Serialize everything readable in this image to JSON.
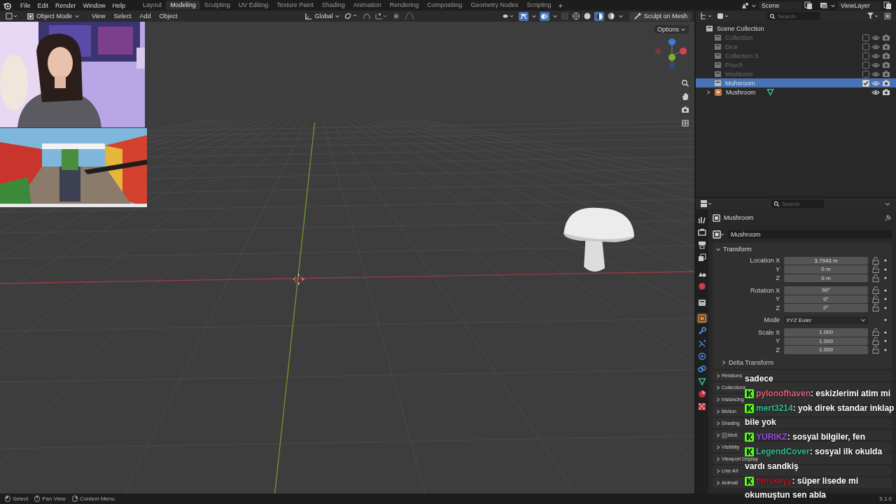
{
  "menu": [
    "File",
    "Edit",
    "Render",
    "Window",
    "Help"
  ],
  "workspaces": [
    {
      "label": "Layout",
      "selected": false
    },
    {
      "label": "Modeling",
      "selected": true
    },
    {
      "label": "Sculpting",
      "selected": false
    },
    {
      "label": "UV Editing",
      "selected": false
    },
    {
      "label": "Texture Paint",
      "selected": false
    },
    {
      "label": "Shading",
      "selected": false
    },
    {
      "label": "Animation",
      "selected": false
    },
    {
      "label": "Rendering",
      "selected": false
    },
    {
      "label": "Compositing",
      "selected": false
    },
    {
      "label": "Geometry Nodes",
      "selected": false
    },
    {
      "label": "Scripting",
      "selected": false
    }
  ],
  "add_workspace": "+",
  "scene": "Scene",
  "view_layer": "ViewLayer",
  "viewport": {
    "mode": "Object Mode",
    "menus": [
      "View",
      "Select",
      "Add",
      "Object"
    ],
    "orientation": "Global",
    "sculpt_button": "Sculpt on Mesh",
    "options": "Options"
  },
  "outliner": {
    "search_placeholder": "Search",
    "root": "Scene Collection",
    "items": [
      {
        "label": "Collection",
        "kind": "collection",
        "checked": false,
        "selected": false
      },
      {
        "label": "Dice",
        "kind": "collection",
        "checked": false,
        "selected": false
      },
      {
        "label": "Collection 3",
        "kind": "collection",
        "checked": false,
        "selected": false
      },
      {
        "label": "Pouch",
        "kind": "collection",
        "checked": false,
        "selected": false
      },
      {
        "label": "Wishbone",
        "kind": "collection",
        "checked": false,
        "selected": false
      },
      {
        "label": "Muhsroom",
        "kind": "collection",
        "checked": true,
        "selected": true
      },
      {
        "label": "Mushroom",
        "kind": "object",
        "expanded": false,
        "selected": false
      }
    ]
  },
  "properties": {
    "search_placeholder": "Search",
    "tabs": [
      {
        "kind": "tool",
        "selected": false
      },
      {
        "kind": "render",
        "selected": false
      },
      {
        "kind": "output",
        "selected": false
      },
      {
        "kind": "view",
        "selected": false
      },
      {
        "kind": "scene",
        "selected": false
      },
      {
        "kind": "world",
        "selected": false
      },
      {
        "kind": "collection",
        "selected": false
      },
      {
        "kind": "object",
        "selected": true
      },
      {
        "kind": "modifier",
        "selected": false
      },
      {
        "kind": "particles",
        "selected": false
      },
      {
        "kind": "physics",
        "selected": false
      },
      {
        "kind": "constraints",
        "selected": false
      },
      {
        "kind": "data",
        "selected": false
      },
      {
        "kind": "material",
        "selected": false
      },
      {
        "kind": "texture",
        "selected": false
      }
    ],
    "object_name": "Mushroom",
    "name_field": "Mushroom",
    "transform": {
      "label": "Transform",
      "expanded": true,
      "groups": [
        [
          {
            "label": "Location X",
            "value": "3.7943 m",
            "kind": "number"
          },
          {
            "label": "Y",
            "value": "0 m",
            "kind": "number"
          },
          {
            "label": "Z",
            "value": "0 m",
            "kind": "number"
          }
        ],
        [
          {
            "label": "Rotation X",
            "value": "90°",
            "kind": "number"
          },
          {
            "label": "Y",
            "value": "0°",
            "kind": "number"
          },
          {
            "label": "Z",
            "value": "0°",
            "kind": "number"
          }
        ],
        [
          {
            "label": "Mode",
            "value": "XYZ Euler",
            "kind": "enum"
          }
        ],
        [
          {
            "label": "Scale X",
            "value": "1.000",
            "kind": "number"
          },
          {
            "label": "Y",
            "value": "1.000",
            "kind": "number"
          },
          {
            "label": "Z",
            "value": "1.000",
            "kind": "number"
          }
        ]
      ],
      "subpanel": {
        "label": "Delta Transform",
        "expanded": false
      }
    },
    "panels": [
      {
        "label": "Relations",
        "expanded": false
      },
      {
        "label": "Collections",
        "expanded": false
      },
      {
        "label": "Instancing",
        "expanded": false
      },
      {
        "label": "Motion",
        "expanded": false
      },
      {
        "label": "Shading",
        "expanded": false
      },
      {
        "label": "Moti",
        "expanded": false,
        "checkbox": true
      },
      {
        "label": "Visibility",
        "expanded": false
      },
      {
        "label": "Viewport Display",
        "expanded": false
      },
      {
        "label": "Line Art",
        "expanded": false
      },
      {
        "label": "Animati",
        "expanded": false
      }
    ]
  },
  "chat": {
    "cut_line": "sadece",
    "messages": [
      {
        "user": "pylonofhaven",
        "color": "#e0607a",
        "text_lines": [
          " : eskizlerimi atim mi"
        ]
      },
      {
        "user": "mert3214",
        "color": "#2fbf8f",
        "text_lines": [
          " : yok direk standar inklap",
          "bile yok"
        ]
      },
      {
        "user": "YURIKZ",
        "color": "#9b4de0",
        "text_lines": [
          " : sosyal bilgiler, fen"
        ]
      },
      {
        "user": "LegendCover",
        "color": "#2fbf8f",
        "text_lines": [
          " : sosyal ilk okulda",
          "vardı sandkiş"
        ]
      },
      {
        "user": "flinskeyy",
        "color": "#b0202a",
        "text_lines": [
          " : süper lisede mi",
          "okumuştun sen abla"
        ]
      }
    ]
  },
  "status_bar": {
    "hints": [
      "Select",
      "Pan View",
      "Context Menu"
    ],
    "version": "5.1.0"
  }
}
